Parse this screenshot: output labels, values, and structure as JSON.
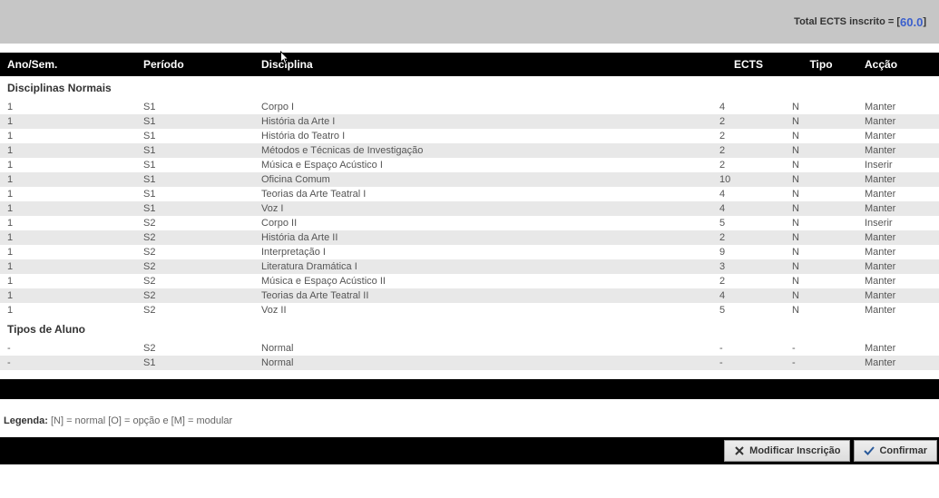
{
  "header": {
    "total_label": "Total ECTS inscrito = [ ",
    "total_value": "60.0",
    "total_suffix": " ]"
  },
  "columns": {
    "ano": "Ano/Sem.",
    "periodo": "Período",
    "disciplina": "Disciplina",
    "ects": "ECTS",
    "tipo": "Tipo",
    "accao": "Acção"
  },
  "sections": {
    "normais": "Disciplinas Normais",
    "tipos": "Tipos de Aluno"
  },
  "rows_normais": [
    {
      "ano": "1",
      "per": "S1",
      "disc": "Corpo I",
      "ects": "4",
      "tipo": "N",
      "accao": "Manter"
    },
    {
      "ano": "1",
      "per": "S1",
      "disc": "História da Arte I",
      "ects": "2",
      "tipo": "N",
      "accao": "Manter"
    },
    {
      "ano": "1",
      "per": "S1",
      "disc": "História do Teatro I",
      "ects": "2",
      "tipo": "N",
      "accao": "Manter"
    },
    {
      "ano": "1",
      "per": "S1",
      "disc": "Métodos e Técnicas de Investigação",
      "ects": "2",
      "tipo": "N",
      "accao": "Manter"
    },
    {
      "ano": "1",
      "per": "S1",
      "disc": "Música e Espaço Acústico I",
      "ects": "2",
      "tipo": "N",
      "accao": "Inserir"
    },
    {
      "ano": "1",
      "per": "S1",
      "disc": "Oficina Comum",
      "ects": "10",
      "tipo": "N",
      "accao": "Manter"
    },
    {
      "ano": "1",
      "per": "S1",
      "disc": "Teorias da Arte Teatral I",
      "ects": "4",
      "tipo": "N",
      "accao": "Manter"
    },
    {
      "ano": "1",
      "per": "S1",
      "disc": "Voz I",
      "ects": "4",
      "tipo": "N",
      "accao": "Manter"
    },
    {
      "ano": "1",
      "per": "S2",
      "disc": "Corpo II",
      "ects": "5",
      "tipo": "N",
      "accao": "Inserir"
    },
    {
      "ano": "1",
      "per": "S2",
      "disc": "História da Arte II",
      "ects": "2",
      "tipo": "N",
      "accao": "Manter"
    },
    {
      "ano": "1",
      "per": "S2",
      "disc": "Interpretação I",
      "ects": "9",
      "tipo": "N",
      "accao": "Manter"
    },
    {
      "ano": "1",
      "per": "S2",
      "disc": "Literatura Dramática I",
      "ects": "3",
      "tipo": "N",
      "accao": "Manter"
    },
    {
      "ano": "1",
      "per": "S2",
      "disc": "Música e Espaço Acústico II",
      "ects": "2",
      "tipo": "N",
      "accao": "Manter"
    },
    {
      "ano": "1",
      "per": "S2",
      "disc": "Teorias da Arte Teatral II",
      "ects": "4",
      "tipo": "N",
      "accao": "Manter"
    },
    {
      "ano": "1",
      "per": "S2",
      "disc": "Voz II",
      "ects": "5",
      "tipo": "N",
      "accao": "Manter"
    }
  ],
  "rows_tipos": [
    {
      "ano": "-",
      "per": "S2",
      "disc": "Normal",
      "ects": "-",
      "tipo": "-",
      "accao": "Manter"
    },
    {
      "ano": "-",
      "per": "S1",
      "disc": "Normal",
      "ects": "-",
      "tipo": "-",
      "accao": "Manter"
    }
  ],
  "legend": {
    "label": "Legenda:",
    "text": "[N] = normal [O] = opção e [M] = modular"
  },
  "footer": {
    "modificar": "Modificar Inscrição",
    "confirmar": "Confirmar"
  }
}
